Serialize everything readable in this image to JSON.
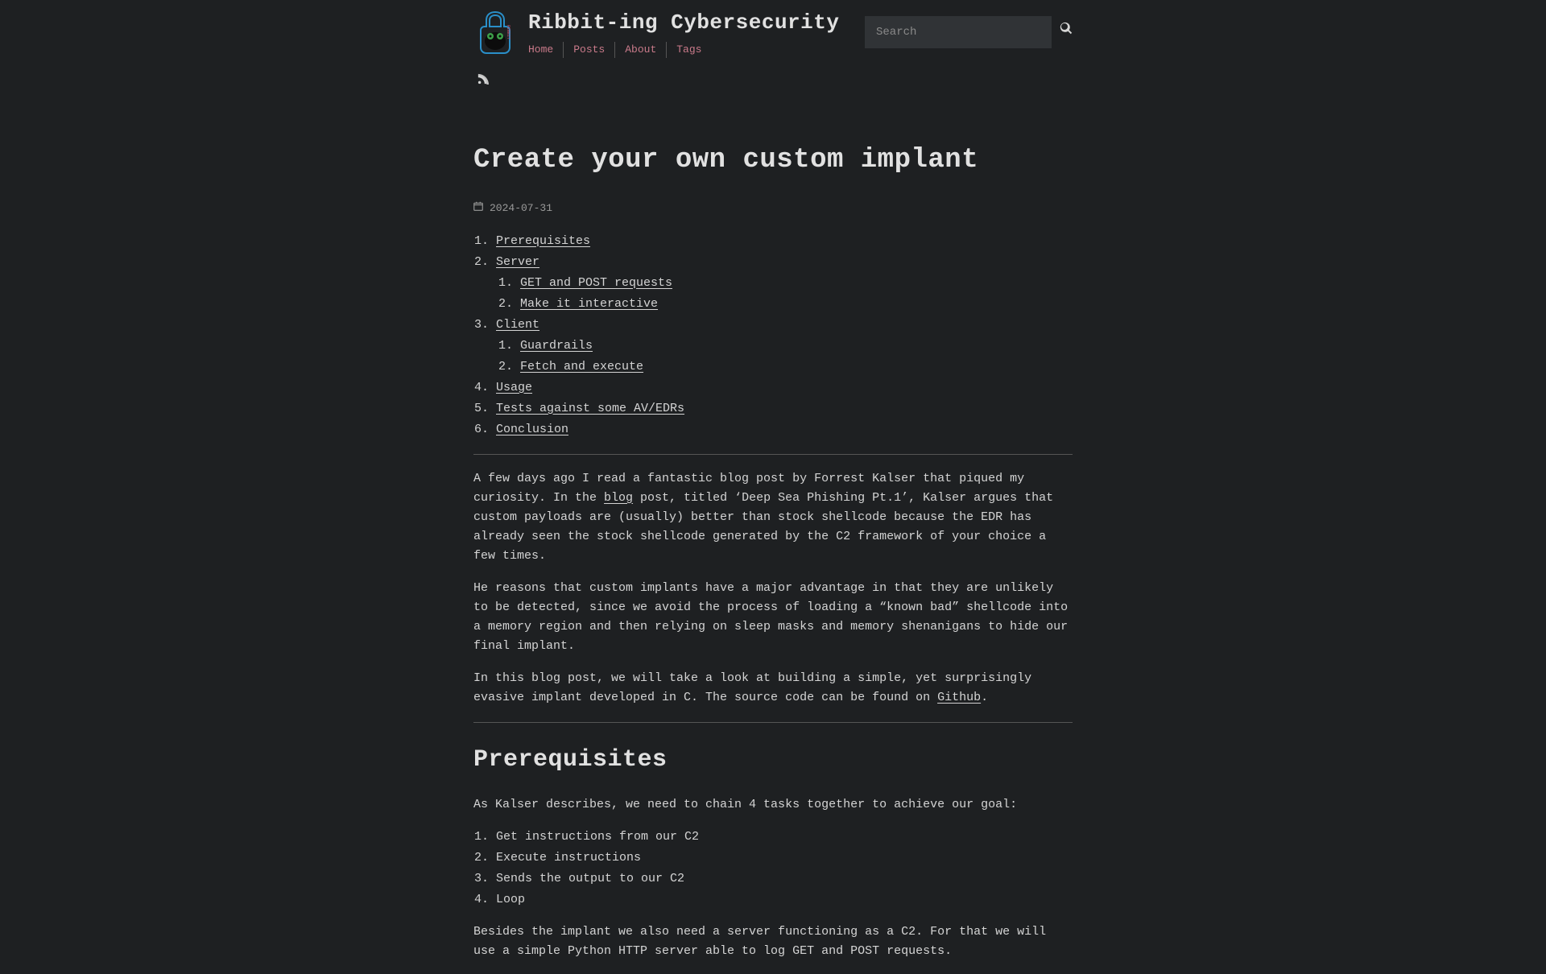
{
  "site": {
    "title": "Ribbit-ing Cybersecurity",
    "nav": {
      "home": "Home",
      "posts": "Posts",
      "about": "About",
      "tags": "Tags"
    },
    "search_placeholder": "Search"
  },
  "post": {
    "title": "Create your own custom implant",
    "date": "2024-07-31",
    "toc": {
      "i1": "Prerequisites",
      "i2": "Server",
      "i2_1": "GET and POST requests",
      "i2_2": "Make it interactive",
      "i3": "Client",
      "i3_1": "Guardrails",
      "i3_2": "Fetch and execute",
      "i4": "Usage",
      "i5": "Tests against some AV/EDRs",
      "i6": "Conclusion"
    },
    "intro": {
      "p1a": "A few days ago I read a fantastic blog post by Forrest Kalser that piqued my curiosity. In the ",
      "p1_link": "blog",
      "p1b": " post, titled ‘Deep Sea Phishing Pt.1’, Kalser argues that custom payloads are (usually) better than stock shellcode because the EDR has already seen the stock shellcode generated by the C2 framework of your choice a few times.",
      "p2": "He reasons that custom implants have a major advantage in that they are unlikely to be detected, since we avoid the process of loading a “known bad” shellcode into a memory region and then relying on sleep masks and memory shenanigans to hide our final implant.",
      "p3a": "In this blog post, we will take a look at building a simple, yet surprisingly evasive implant developed in C. The source code can be found on ",
      "p3_link": "Github",
      "p3b": "."
    },
    "section1": {
      "title": "Prerequisites",
      "p1": "As Kalser describes, we need to chain 4 tasks together to achieve our goal:",
      "tasks": {
        "t1": "Get instructions from our C2",
        "t2": "Execute instructions",
        "t3": "Sends the output to our C2",
        "t4": "Loop"
      },
      "p2": "Besides the implant we also need a server functioning as a C2. For that we will use a simple Python HTTP server able to log GET and POST requests."
    }
  }
}
